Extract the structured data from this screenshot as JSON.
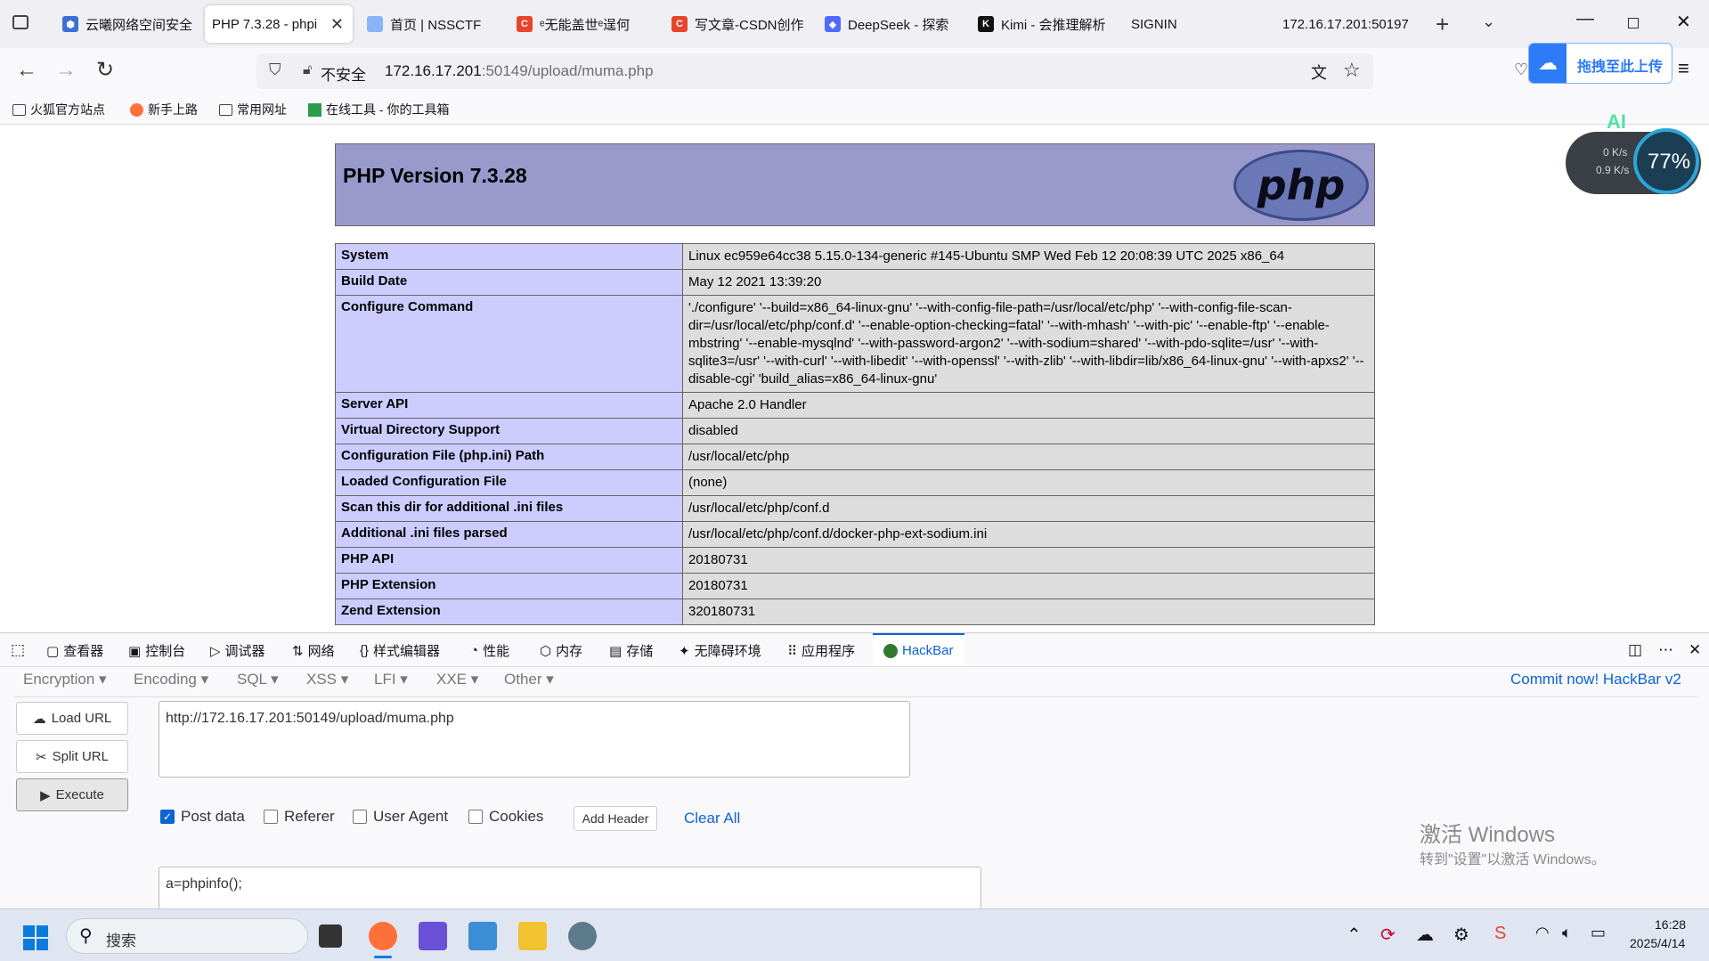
{
  "tabs": [
    {
      "label": "云曦网络空间安全",
      "favicon_color": "#3b6fd6"
    },
    {
      "label": "PHP 7.3.28 - phpi",
      "favicon_color": "#ffffff",
      "active": true
    },
    {
      "label": "首页 | NSSCTF",
      "favicon_color": "#8ab4f8"
    },
    {
      "label": "ᵉ无能盖世ᵉ逞何",
      "favicon_color": "#e8432b"
    },
    {
      "label": "写文章-CSDN创作",
      "favicon_color": "#e8432b"
    },
    {
      "label": "DeepSeek - 探索",
      "favicon_color": "#4d6bfe"
    },
    {
      "label": "Kimi - 会推理解析",
      "favicon_color": "#111111"
    },
    {
      "label": "SIGNIN",
      "favicon_color": ""
    },
    {
      "label": "172.16.17.201:50197",
      "favicon_color": ""
    }
  ],
  "nav": {
    "insecure_label": "不安全",
    "url_host": "172.16.17.201",
    "url_rest": ":50149/upload/muma.php",
    "upload_button": "拖拽至此上传"
  },
  "bookmarks": [
    "火狐官方站点",
    "新手上路",
    "常用网址",
    "在线工具 - 你的工具箱"
  ],
  "netspeed": {
    "up": "0 K/s",
    "down": "0.9 K/s",
    "percent": "77%",
    "ai": "AI"
  },
  "phpinfo": {
    "title": "PHP Version 7.3.28",
    "logo_text": "php",
    "rows": [
      {
        "key": "System",
        "value": "Linux ec959e64cc38 5.15.0-134-generic #145-Ubuntu SMP Wed Feb 12 20:08:39 UTC 2025 x86_64"
      },
      {
        "key": "Build Date",
        "value": "May 12 2021 13:39:20"
      },
      {
        "key": "Configure Command",
        "value": "'./configure' '--build=x86_64-linux-gnu' '--with-config-file-path=/usr/local/etc/php' '--with-config-file-scan-dir=/usr/local/etc/php/conf.d' '--enable-option-checking=fatal' '--with-mhash' '--with-pic' '--enable-ftp' '--enable-mbstring' '--enable-mysqlnd' '--with-password-argon2' '--with-sodium=shared' '--with-pdo-sqlite=/usr' '--with-sqlite3=/usr' '--with-curl' '--with-libedit' '--with-openssl' '--with-zlib' '--with-libdir=lib/x86_64-linux-gnu' '--with-apxs2' '--disable-cgi' 'build_alias=x86_64-linux-gnu'"
      },
      {
        "key": "Server API",
        "value": "Apache 2.0 Handler"
      },
      {
        "key": "Virtual Directory Support",
        "value": "disabled"
      },
      {
        "key": "Configuration File (php.ini) Path",
        "value": "/usr/local/etc/php"
      },
      {
        "key": "Loaded Configuration File",
        "value": "(none)"
      },
      {
        "key": "Scan this dir for additional .ini files",
        "value": "/usr/local/etc/php/conf.d"
      },
      {
        "key": "Additional .ini files parsed",
        "value": "/usr/local/etc/php/conf.d/docker-php-ext-sodium.ini"
      },
      {
        "key": "PHP API",
        "value": "20180731"
      },
      {
        "key": "PHP Extension",
        "value": "20180731"
      },
      {
        "key": "Zend Extension",
        "value": "320180731"
      }
    ]
  },
  "devtools": {
    "tabs": [
      "查看器",
      "控制台",
      "调试器",
      "网络",
      "样式编辑器",
      "性能",
      "内存",
      "存储",
      "无障碍环境",
      "应用程序",
      "HackBar"
    ],
    "active_tab": "HackBar"
  },
  "hackbar": {
    "menus": [
      "Encryption ▾",
      "Encoding ▾",
      "SQL ▾",
      "XSS ▾",
      "LFI ▾",
      "XXE ▾",
      "Other ▾"
    ],
    "commit_label": "Commit now! HackBar v2",
    "load_url": "Load URL",
    "split_url": "Split URL",
    "execute": "Execute",
    "url_value": "http://172.16.17.201:50149/upload/muma.php",
    "options": [
      {
        "label": "Post data",
        "checked": true
      },
      {
        "label": "Referer",
        "checked": false
      },
      {
        "label": "User Agent",
        "checked": false
      },
      {
        "label": "Cookies",
        "checked": false
      }
    ],
    "add_header": "Add Header",
    "clear_all": "Clear All",
    "post_value": "a=phpinfo();"
  },
  "watermark": {
    "line1": "激活 Windows",
    "line2": "转到\"设置\"以激活 Windows。"
  },
  "taskbar": {
    "search_placeholder": "搜索",
    "time": "16:28",
    "date": "2025/4/14"
  }
}
